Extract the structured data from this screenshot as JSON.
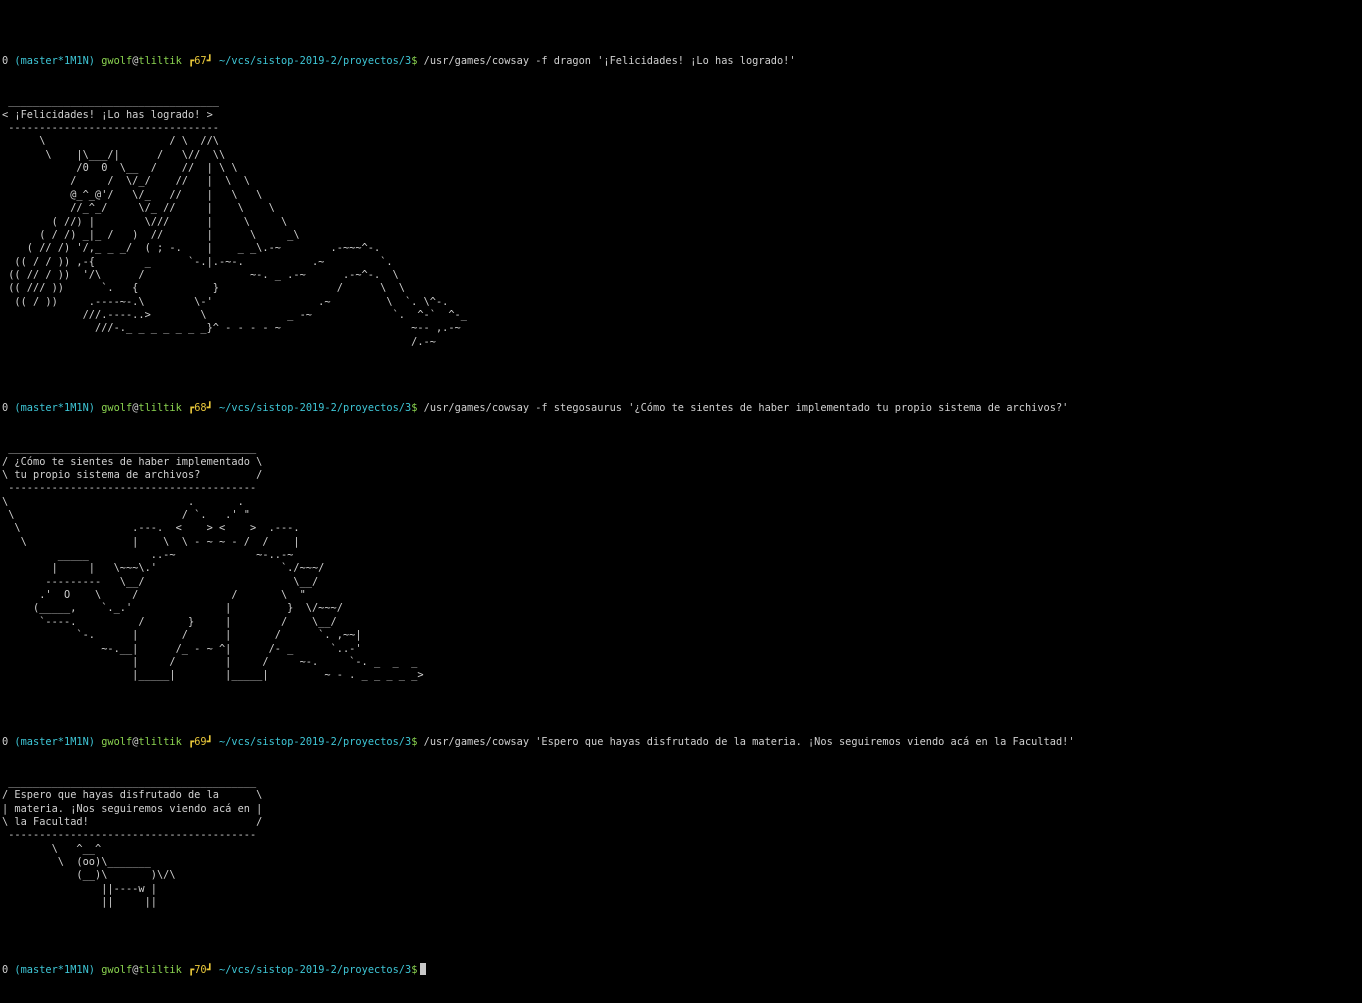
{
  "prompt": {
    "status": "0",
    "branch": "(master*1M1N)",
    "user": "gwolf",
    "at": "@",
    "host": "tliltik",
    "path": "~/vcs/sistop-2019-2/proyectos/3",
    "dollar": "$"
  },
  "blocks": [
    {
      "hist": "┏67┛",
      "command": "/usr/games/cowsay -f dragon '¡Felicidades! ¡Lo has logrado!'",
      "output": " __________________________________\n< ¡Felicidades! ¡Lo has logrado! >\n ----------------------------------\n      \\                    / \\  //\\\n       \\    |\\___/|      /   \\//  \\\\\n            /0  0  \\__  /    //  | \\ \\\n           /     /  \\/_/    //   |  \\  \\\n           @_^_@'/   \\/_   //    |   \\   \\\n           //_^_/     \\/_ //     |    \\    \\\n        ( //) |        \\///      |     \\     \\\n      ( / /) _|_ /   )  //       |      \\     _\\\n    ( // /) '/,_ _ _/  ( ; -.    |    _ _\\.-~        .-~~~^-.\n  (( / / )) ,-{        _      `-.|.-~-.           .~         `.\n (( // / ))  '/\\      /                 ~-. _ .-~      .-~^-.  \\\n (( /// ))      `.   {            }                   /      \\  \\\n  (( / ))     .----~-.\\        \\-'                 .~         \\  `. \\^-.\n             ///.----..>        \\             _ -~             `.  ^-`  ^-_\n               ///-._ _ _ _ _ _ _}^ - - - - ~                     ~-- ,.-~\n                                                                  /.-~"
    },
    {
      "hist": "┏68┛",
      "command": "/usr/games/cowsay -f stegosaurus '¿Cómo te sientes de haber implementado tu propio sistema de archivos?'",
      "output": " ________________________________________\n/ ¿Cómo te sientes de haber implementado \\\n\\ tu propio sistema de archivos?         /\n ----------------------------------------\n\\                             .       .\n \\                           / `.   .' \"\n  \\                  .---.  <    > <    >  .---.\n   \\                 |    \\  \\ - ~ ~ - /  /    |\n         _____          ..-~             ~-..-~\n        |     |   \\~~~\\.'                    `./~~~/\n       ---------   \\__/                        \\__/\n      .'  O    \\     /               /       \\  \"\n     (_____,    `._.'               |         }  \\/~~~/\n      `----.          /       }     |        /    \\__/\n            `-.      |       /      |       /      `. ,~~|\n                ~-.__|      /_ - ~ ^|      /- _      `..-'\n                     |     /        |     /     ~-.     `-. _  _  _\n                     |_____|        |_____|         ~ - . _ _ _ _ _>"
    },
    {
      "hist": "┏69┛",
      "command": "/usr/games/cowsay 'Espero que hayas disfrutado de la materia. ¡Nos seguiremos viendo acá en la Facultad!'",
      "output": " ________________________________________\n/ Espero que hayas disfrutado de la      \\\n| materia. ¡Nos seguiremos viendo acá en |\n\\ la Facultad!                           /\n ----------------------------------------\n        \\   ^__^\n         \\  (oo)\\_______\n            (__)\\       )\\/\\\n                ||----w |\n                ||     ||"
    }
  ],
  "final": {
    "hist": "┏70┛"
  }
}
